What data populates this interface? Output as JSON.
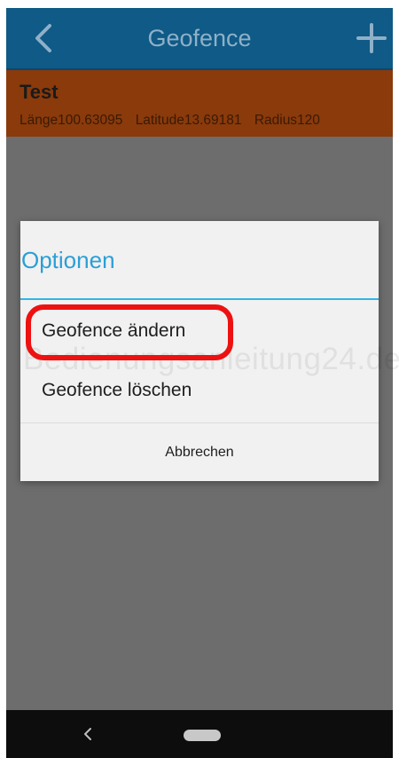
{
  "header": {
    "title": "Geofence",
    "back_icon": "chevron-left-icon",
    "add_icon": "plus-icon"
  },
  "geofence_list": {
    "items": [
      {
        "name": "Test",
        "longitude": "Länge100.63095",
        "latitude": "Latitude13.69181",
        "radius": "Radius120"
      }
    ]
  },
  "dialog": {
    "title": "Optionen",
    "options": [
      {
        "label": "Geofence ändern"
      },
      {
        "label": "Geofence löschen"
      }
    ],
    "cancel_label": "Abbrechen"
  },
  "watermark": "Bedienungsanleitung24.de",
  "navbar": {
    "back_icon": "back-icon",
    "home_icon": "home-pill-icon"
  },
  "colors": {
    "appbar": "#0f5a86",
    "list_item": "#8a3a0b",
    "dialog_title": "#2a9fd6",
    "highlight": "#ee1111"
  }
}
